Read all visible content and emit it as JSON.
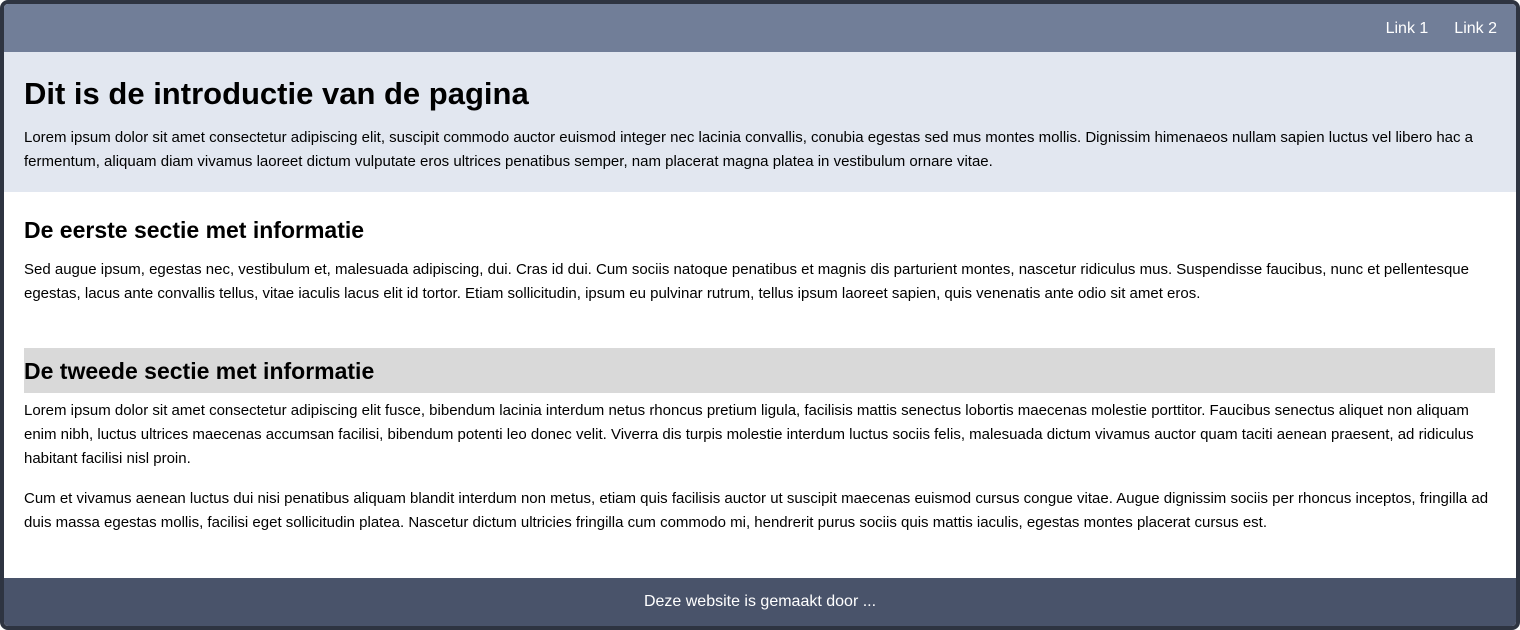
{
  "nav": {
    "links": [
      "Link 1",
      "Link 2"
    ]
  },
  "intro": {
    "title": "Dit is de introductie van de pagina",
    "text": "Lorem ipsum dolor sit amet consectetur adipiscing elit, suscipit commodo auctor euismod integer nec lacinia convallis, conubia egestas sed mus montes mollis. Dignissim himenaeos nullam sapien luctus vel libero hac a fermentum, aliquam diam vivamus laoreet dictum vulputate eros ultrices penatibus semper, nam placerat magna platea in vestibulum ornare vitae."
  },
  "section1": {
    "title": "De eerste sectie met informatie",
    "text": "Sed augue ipsum, egestas nec, vestibulum et, malesuada adipiscing, dui. Cras id dui. Cum sociis natoque penatibus et magnis dis parturient montes, nascetur ridiculus mus. Suspendisse faucibus, nunc et pellentesque egestas, lacus ante convallis tellus, vitae iaculis lacus elit id tortor. Etiam sollicitudin, ipsum eu pulvinar rutrum, tellus ipsum laoreet sapien, quis venenatis ante odio sit amet eros."
  },
  "section2": {
    "title": "De tweede sectie met informatie",
    "paragraphs": [
      "Lorem ipsum dolor sit amet consectetur adipiscing elit fusce, bibendum lacinia interdum netus rhoncus pretium ligula, facilisis mattis senectus lobortis maecenas molestie porttitor. Faucibus senectus aliquet non aliquam enim nibh, luctus ultrices maecenas accumsan facilisi, bibendum potenti leo donec velit. Viverra dis turpis molestie interdum luctus sociis felis, malesuada dictum vivamus auctor quam taciti aenean praesent, ad ridiculus habitant facilisi nisl proin.",
      "Cum et vivamus aenean luctus dui nisi penatibus aliquam blandit interdum non metus, etiam quis facilisis auctor ut suscipit maecenas euismod cursus congue vitae. Augue dignissim sociis per rhoncus inceptos, fringilla ad duis massa egestas mollis, facilisi eget sollicitudin platea. Nascetur dictum ultricies fringilla cum commodo mi, hendrerit purus sociis quis mattis iaculis, egestas montes placerat cursus est."
    ]
  },
  "footer": {
    "text": "Deze website is gemaakt door ..."
  },
  "colors": {
    "nav_bg": "#717e98",
    "intro_bg": "#e2e7f0",
    "heading_bar_bg": "#d9d9d9",
    "footer_bg": "#49536a",
    "frame_border": "#2e3441"
  }
}
